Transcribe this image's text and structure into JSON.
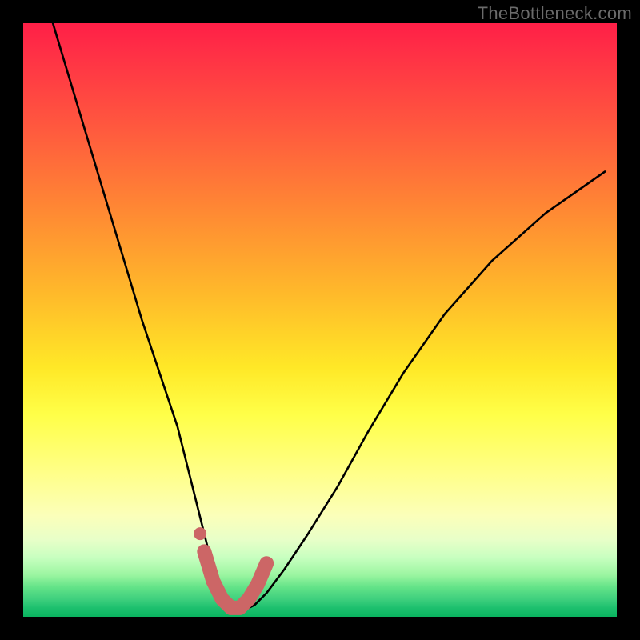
{
  "watermark": "TheBottleneck.com",
  "colors": {
    "background": "#000000",
    "gradient_top": "#ff1f47",
    "gradient_bottom": "#0ab45f",
    "curve": "#000000",
    "marker": "#cc6666"
  },
  "chart_data": {
    "type": "line",
    "title": "",
    "xlabel": "",
    "ylabel": "",
    "xlim": [
      0,
      100
    ],
    "ylim": [
      0,
      100
    ],
    "grid": false,
    "legend": false,
    "series": [
      {
        "name": "bottleneck-curve",
        "x": [
          5,
          8,
          11,
          14,
          17,
          20,
          23,
          26,
          28,
          30,
          31.5,
          33,
          35,
          37,
          39,
          41,
          44,
          48,
          53,
          58,
          64,
          71,
          79,
          88,
          98
        ],
        "values": [
          100,
          90,
          80,
          70,
          60,
          50,
          41,
          32,
          24,
          16,
          10,
          5,
          2,
          1,
          2,
          4,
          8,
          14,
          22,
          31,
          41,
          51,
          60,
          68,
          75
        ]
      }
    ],
    "highlight": {
      "name": "valley-marker",
      "x": [
        30.5,
        32.0,
        33.5,
        35.0,
        36.5,
        38.0,
        39.5,
        41.0
      ],
      "values": [
        11.0,
        6.0,
        3.0,
        1.5,
        1.5,
        3.0,
        5.5,
        9.0
      ]
    }
  }
}
